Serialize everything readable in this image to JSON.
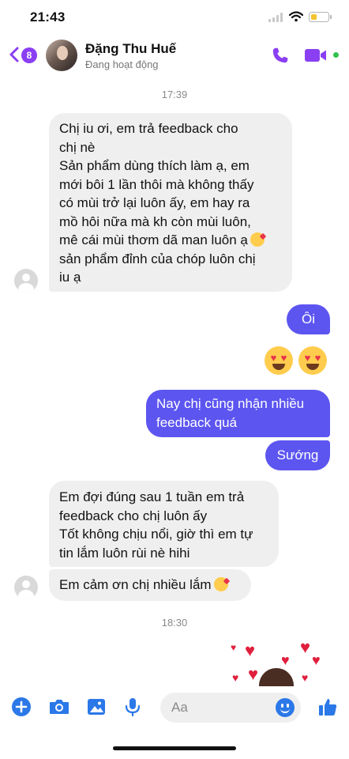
{
  "status_bar": {
    "time": "21:43",
    "battery_level": 0.35,
    "battery_color": "#f4c430"
  },
  "header": {
    "back_badge": "8",
    "contact_name": "Đặng Thu Huế",
    "contact_status": "Đang hoạt động",
    "accent_color": "#8a3ff2",
    "icons": [
      "chevron-left-icon",
      "phone-icon",
      "video-camera-icon"
    ],
    "online": true
  },
  "messages": {
    "ts1": "17:39",
    "m1": {
      "l1": "Chị iu ơi, em trả feedback cho",
      "l2": "chị nè",
      "l3": "Sản phẩm dùng thích làm ạ, em",
      "l4": "mới bôi 1 lần thôi mà không thấy",
      "l5": "có mùi trở lại luôn ấy, em hay ra",
      "l6": "mồ hôi nữa mà kh còn mùi luôn,",
      "l7": "mê cái mùi thơm dã man luôn ạ",
      "l8": "sản phẩm đỉnh của chóp luôn chị",
      "l9": "iu ạ"
    },
    "m2": "Ôi",
    "m3_emoji": "heart-eyes-emoji x2",
    "m4": {
      "l1": "Nay chị cũng nhận nhiều",
      "l2": "feedback quá"
    },
    "m5": "Sướng",
    "m6": {
      "l1": "Em đợi đúng sau 1 tuần em trả",
      "l2": "feedback cho chị luôn ấy",
      "l3": "Tốt không chịu nổi, giờ thì em tự",
      "l4": "tin lắm luôn rùi nè hihi"
    },
    "m7": "Em cảm ơn chị nhiều lắm",
    "ts2": "18:30",
    "outgoing_color": "#5c55f0",
    "incoming_color": "#efefef"
  },
  "composer": {
    "placeholder": "Aa",
    "icons": [
      "plus-circle-icon",
      "camera-icon",
      "photo-icon",
      "microphone-icon",
      "emoji-icon",
      "thumbs-up-icon"
    ],
    "icon_color": "#2b78e8"
  }
}
